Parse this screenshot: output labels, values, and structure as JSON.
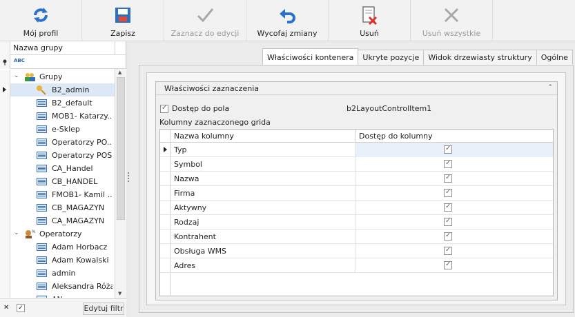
{
  "toolbar": {
    "buttons": [
      {
        "label": "Mój profil",
        "icon": "refresh-icon",
        "enabled": true
      },
      {
        "label": "Zapisz",
        "icon": "save-icon",
        "enabled": true
      },
      {
        "label": "Zaznacz do edycji",
        "icon": "checkmark-icon",
        "enabled": false
      },
      {
        "label": "Wycofaj zmiany",
        "icon": "undo-icon",
        "enabled": true
      },
      {
        "label": "Usuń",
        "icon": "delete-document-icon",
        "enabled": true
      },
      {
        "label": "Usuń wszystkie",
        "icon": "close-x-icon",
        "enabled": false
      }
    ]
  },
  "left": {
    "header": "Nazwa grupy",
    "filter_label": "ABC",
    "groups_label": "Grupy",
    "groups": [
      "B2_admin",
      "B2_default",
      "MOB1- Katarzy...",
      "e-Sklep",
      "Operatorzy PO...",
      "Operatorzy POS",
      "CA_Handel",
      "CB_HANDEL",
      "FMOB1- Kamil ...",
      "CB_MAGAZYN",
      "CA_MAGAZYN"
    ],
    "operators_label": "Operatorzy",
    "operators": [
      "Adam Horbacz",
      "Adam Kowalski",
      "admin",
      "Aleksandra Róża",
      "AN..."
    ],
    "edit_filter": "Edytuj filtr"
  },
  "tabs": [
    "Właściwości kontenera",
    "Ukryte pozycje",
    "Widok drzewiasty struktury",
    "Ogólne"
  ],
  "panel": {
    "group_title": "Właściwości zaznaczenia",
    "access_label": "Dostęp do pola",
    "control_name": "b2LayoutControlItem1",
    "grid_label": "Kolumny zaznaczonego grida",
    "col_name_header": "Nazwa kolumny",
    "col_access_header": "Dostęp do kolumny",
    "rows": [
      "Typ",
      "Symbol",
      "Nazwa",
      "Firma",
      "Aktywny",
      "Rodzaj",
      "Kontrahent",
      "Obsługa WMS",
      "Adres"
    ]
  }
}
